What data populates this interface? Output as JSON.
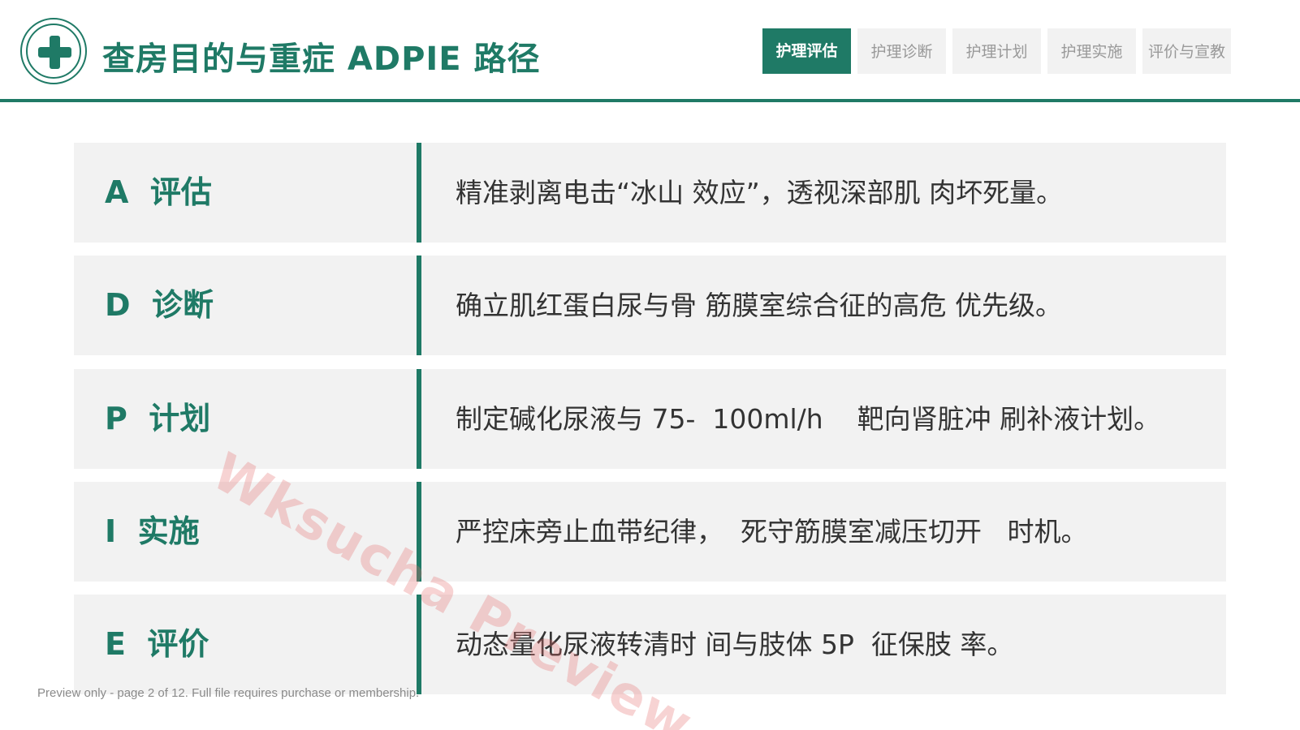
{
  "header": {
    "title": "查房目的与重症 ADPIE 路径",
    "tabs": [
      {
        "label": "护理评估",
        "active": true
      },
      {
        "label": "护理诊断",
        "active": false
      },
      {
        "label": "护理计划",
        "active": false
      },
      {
        "label": "护理实施",
        "active": false
      },
      {
        "label": "评价与宣教",
        "active": false
      }
    ]
  },
  "rows": [
    {
      "label": "A  评估",
      "text": "精准剥离电击“冰山 效应”，透视深部肌 肉坏死量。"
    },
    {
      "label": "D  诊断",
      "text": "确立肌红蛋白尿与骨 筋膜室综合征的高危 优先级。"
    },
    {
      "label": "P  计划",
      "text": "制定碱化尿液与 75-  100ml/h    靶向肾脏冲 刷补液计划。"
    },
    {
      "label": "I  实施",
      "text": "严控床旁止血带纪律，  死守筋膜室减压切开   时机。"
    },
    {
      "label": "E  评价",
      "text": "动态量化尿液转清时 间与肢体 5P  征保肢 率。"
    }
  ],
  "watermark": "Wksucha Preview",
  "preview_note": "Preview only - page 2 of 12. Full file requires purchase or membership.",
  "colors": {
    "accent": "#1f7a66",
    "row_background": "#f2f2f2",
    "tab_inactive_text": "#999999",
    "watermark": "#e46e6e"
  }
}
